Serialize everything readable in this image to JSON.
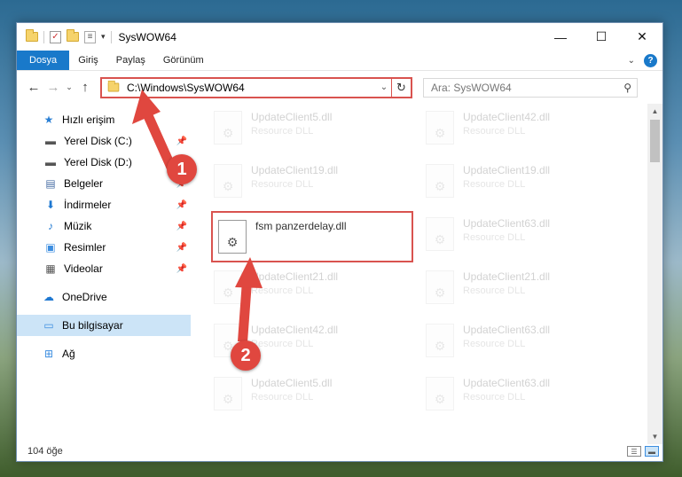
{
  "window": {
    "title": "SysWOW64",
    "controls": {
      "minimize": "—",
      "maximize": "☐",
      "close": "✕"
    }
  },
  "ribbon": {
    "tabs": [
      "Dosya",
      "Giriş",
      "Paylaş",
      "Görünüm"
    ],
    "help": "?"
  },
  "nav": {
    "address": "C:\\Windows\\SysWOW64",
    "search_placeholder": "Ara: SysWOW64"
  },
  "sidebar": {
    "quick_access": "Hızlı erişim",
    "items": [
      {
        "label": "Yerel Disk (C:)",
        "icon": "drive-icon",
        "pinned": true
      },
      {
        "label": "Yerel Disk (D:)",
        "icon": "drive-icon",
        "pinned": false
      },
      {
        "label": "Belgeler",
        "icon": "documents-icon",
        "pinned": true
      },
      {
        "label": "İndirmeler",
        "icon": "downloads-icon",
        "pinned": true
      },
      {
        "label": "Müzik",
        "icon": "music-icon",
        "pinned": true
      },
      {
        "label": "Resimler",
        "icon": "pictures-icon",
        "pinned": true
      },
      {
        "label": "Videolar",
        "icon": "videos-icon",
        "pinned": true
      }
    ],
    "onedrive": "OneDrive",
    "this_pc": "Bu bilgisayar",
    "network": "Ağ"
  },
  "files": {
    "left": [
      {
        "name": "UpdateClient5.dll",
        "type": "Resource DLL",
        "faded": true
      },
      {
        "name": "UpdateClient19.dll",
        "type": "Resource DLL",
        "faded": true
      },
      {
        "name": "fsm panzerdelay.dll",
        "type": "",
        "faded": false
      },
      {
        "name": "UpdateClient21.dll",
        "type": "Resource DLL",
        "faded": true
      },
      {
        "name": "UpdateClient42.dll",
        "type": "Resource DLL",
        "faded": true
      },
      {
        "name": "UpdateClient5.dll",
        "type": "Resource DLL",
        "faded": true
      }
    ],
    "right": [
      {
        "name": "UpdateClient42.dll",
        "type": "Resource DLL",
        "faded": true
      },
      {
        "name": "UpdateClient19.dll",
        "type": "Resource DLL",
        "faded": true
      },
      {
        "name": "UpdateClient63.dll",
        "type": "Resource DLL",
        "faded": true
      },
      {
        "name": "UpdateClient21.dll",
        "type": "Resource DLL",
        "faded": true
      },
      {
        "name": "UpdateClient63.dll",
        "type": "Resource DLL",
        "faded": true
      },
      {
        "name": "UpdateClient63.dll",
        "type": "Resource DLL",
        "faded": true
      }
    ]
  },
  "status": {
    "count": "104 öğe"
  },
  "callouts": {
    "one": "1",
    "two": "2"
  },
  "colors": {
    "accent": "#1979ca",
    "highlight": "#d9534f",
    "callout": "#e0473f"
  }
}
